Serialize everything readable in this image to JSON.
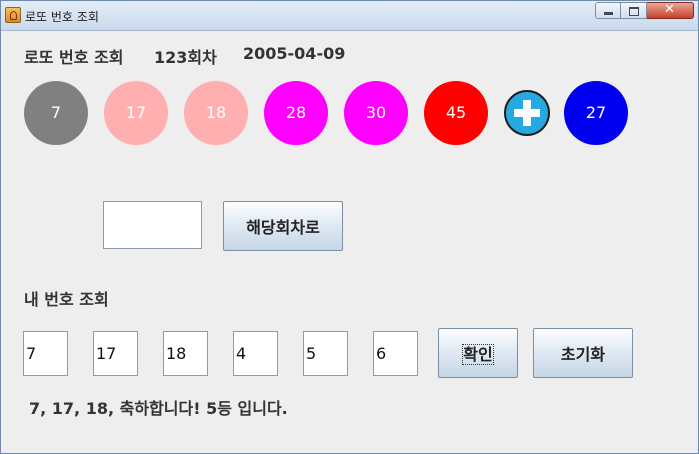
{
  "window": {
    "title": "로또 번호 조회",
    "close_label": "✕"
  },
  "header": {
    "title": "로또 번호 조회",
    "round": "123회차",
    "date": "2005-04-09"
  },
  "draw": {
    "balls": [
      {
        "number": "7",
        "color": "#808080"
      },
      {
        "number": "17",
        "color": "#ffafaf"
      },
      {
        "number": "18",
        "color": "#ffafaf"
      },
      {
        "number": "28",
        "color": "#ff00ff"
      },
      {
        "number": "30",
        "color": "#ff00ff"
      },
      {
        "number": "45",
        "color": "#ff0000"
      }
    ],
    "plus_icon": "plus-icon",
    "bonus": {
      "number": "27",
      "color": "#0000ee"
    }
  },
  "round_search": {
    "input_value": "",
    "button_label": "해당회차로"
  },
  "my_numbers": {
    "title": "내 번호 조회",
    "inputs": [
      "7",
      "17",
      "18",
      "4",
      "5",
      "6"
    ],
    "confirm_label": "확인",
    "reset_label": "초기화"
  },
  "result": {
    "message": "7,  17,  18, 축하합니다! 5등 입니다."
  }
}
